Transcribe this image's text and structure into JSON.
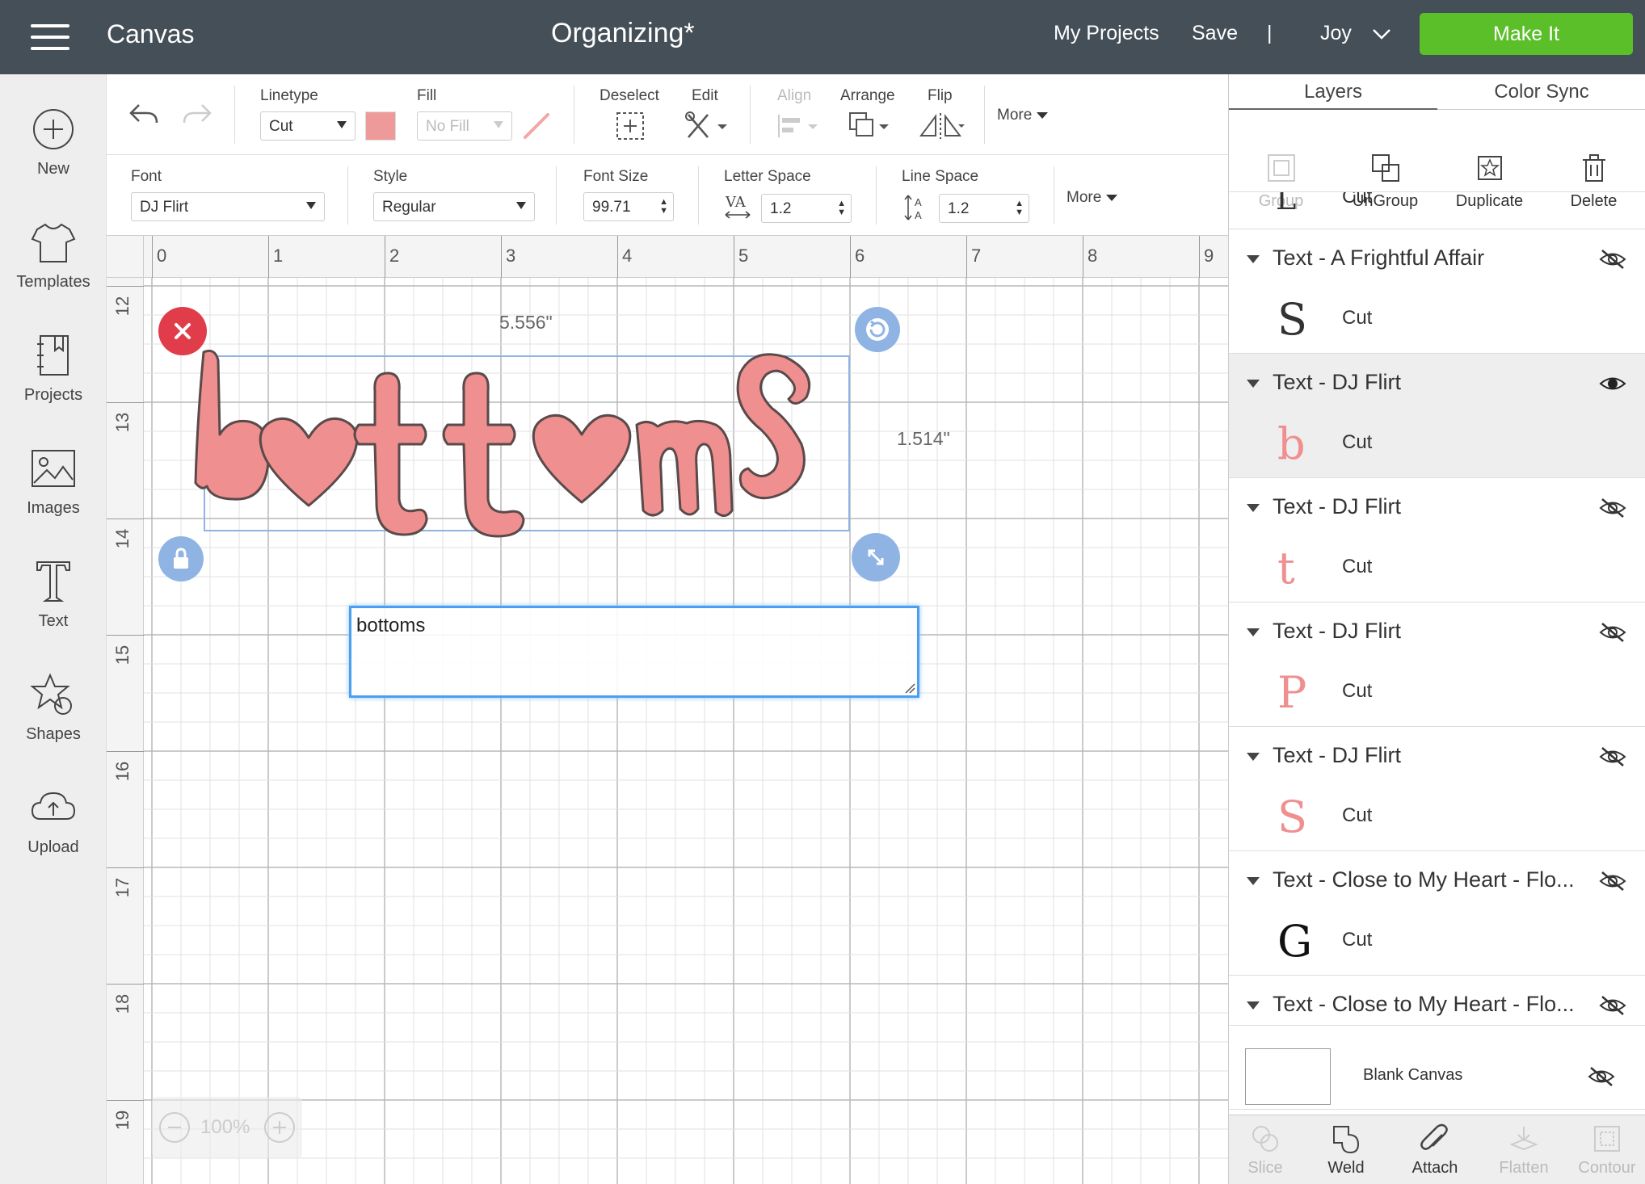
{
  "topbar": {
    "app_title": "Canvas",
    "project_title": "Organizing*",
    "my_projects": "My Projects",
    "save": "Save",
    "separator": "|",
    "user": "Joy",
    "make_it": "Make It"
  },
  "sidebar": {
    "items": [
      {
        "label": "New",
        "icon": "plus-circle-icon"
      },
      {
        "label": "Templates",
        "icon": "tshirt-icon"
      },
      {
        "label": "Projects",
        "icon": "notebook-icon"
      },
      {
        "label": "Images",
        "icon": "image-icon"
      },
      {
        "label": "Text",
        "icon": "text-icon"
      },
      {
        "label": "Shapes",
        "icon": "shapes-icon"
      },
      {
        "label": "Upload",
        "icon": "cloud-upload-icon"
      }
    ]
  },
  "toolbar1": {
    "linetype_label": "Linetype",
    "linetype_value": "Cut",
    "fill_label": "Fill",
    "fill_value": "No Fill",
    "deselect_label": "Deselect",
    "edit_label": "Edit",
    "align_label": "Align",
    "arrange_label": "Arrange",
    "flip_label": "Flip",
    "more_label": "More",
    "swatch_color": "#ef9a9a"
  },
  "toolbar2": {
    "font_label": "Font",
    "font_value": "DJ Flirt",
    "style_label": "Style",
    "style_value": "Regular",
    "font_size_label": "Font Size",
    "font_size_value": "99.71",
    "letter_space_label": "Letter Space",
    "letter_space_value": "1.2",
    "line_space_label": "Line Space",
    "line_space_value": "1.2",
    "more_label": "More"
  },
  "canvas": {
    "ruler_top": [
      "0",
      "1",
      "2",
      "3",
      "4",
      "5",
      "6",
      "7",
      "8",
      "9"
    ],
    "ruler_left": [
      "12",
      "13",
      "14",
      "15",
      "16",
      "17",
      "18",
      "19"
    ],
    "width_readout": "5.556\"",
    "height_readout": "1.514\"",
    "text_input_value": "bottoms",
    "zoom": "100%",
    "text_color": "#ef8f8f"
  },
  "panel": {
    "tabs": [
      "Layers",
      "Color Sync"
    ],
    "actions": [
      {
        "label": "Group",
        "enabled": false
      },
      {
        "label": "UnGroup",
        "enabled": true
      },
      {
        "label": "Duplicate",
        "enabled": true
      },
      {
        "label": "Delete",
        "enabled": true
      }
    ],
    "partial_item_kind": "Cut",
    "layers": [
      {
        "title": "Text - A Frightful Affair",
        "glyph": "S",
        "kind": "Cut",
        "visible": false,
        "selected": false,
        "color": "#333333"
      },
      {
        "title": "Text - DJ Flirt",
        "glyph": "b",
        "kind": "Cut",
        "visible": true,
        "selected": true,
        "color": "#ef8f8f"
      },
      {
        "title": "Text - DJ Flirt",
        "glyph": "t",
        "kind": "Cut",
        "visible": false,
        "selected": false,
        "color": "#ef8f8f"
      },
      {
        "title": "Text - DJ Flirt",
        "glyph": "P",
        "kind": "Cut",
        "visible": false,
        "selected": false,
        "color": "#ef8f8f"
      },
      {
        "title": "Text - DJ Flirt",
        "glyph": "S",
        "kind": "Cut",
        "visible": false,
        "selected": false,
        "color": "#ef8f8f"
      },
      {
        "title": "Text - Close to My Heart - Flo...",
        "glyph": "G",
        "kind": "Cut",
        "visible": false,
        "selected": false,
        "color": "#111111"
      },
      {
        "title": "Text - Close to My Heart - Flo...",
        "glyph": "",
        "kind": "",
        "visible": false,
        "selected": false,
        "color": "#111111"
      }
    ],
    "blank_canvas": "Blank Canvas",
    "bottom_actions": [
      {
        "label": "Slice",
        "enabled": false
      },
      {
        "label": "Weld",
        "enabled": true
      },
      {
        "label": "Attach",
        "enabled": true
      },
      {
        "label": "Flatten",
        "enabled": false
      },
      {
        "label": "Contour",
        "enabled": false
      }
    ]
  }
}
